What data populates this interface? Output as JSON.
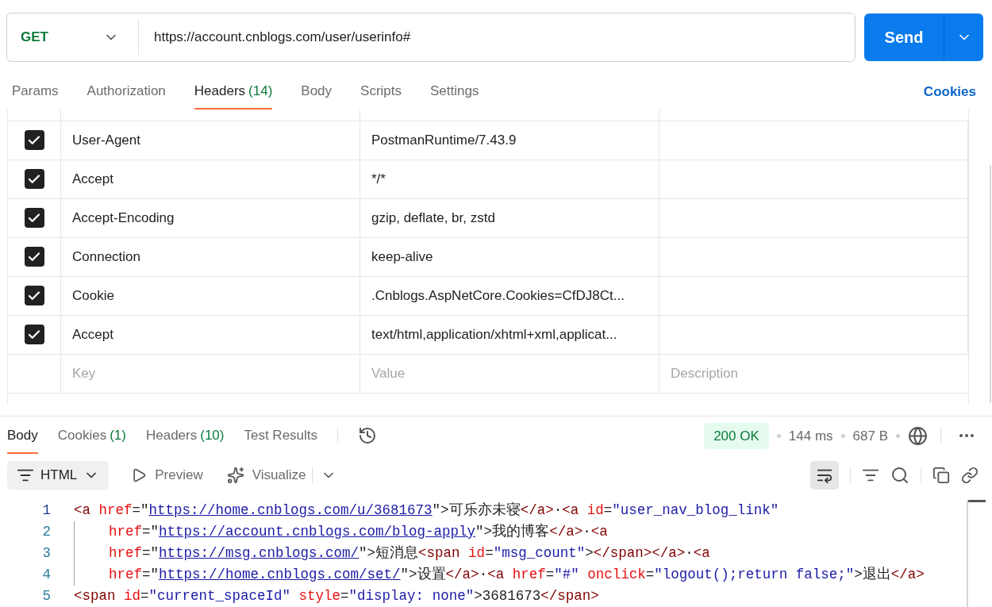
{
  "request": {
    "method": "GET",
    "url": "https://account.cnblogs.com/user/userinfo#",
    "send": "Send"
  },
  "request_tabs": [
    {
      "label": "Params",
      "selected": false
    },
    {
      "label": "Authorization",
      "selected": false
    },
    {
      "label": "Headers",
      "count": "(14)",
      "selected": true
    },
    {
      "label": "Body",
      "selected": false
    },
    {
      "label": "Scripts",
      "selected": false
    },
    {
      "label": "Settings",
      "selected": false
    }
  ],
  "cookies_link": "Cookies",
  "headers": {
    "rows": [
      {
        "checked": true,
        "key": "User-Agent",
        "value": "PostmanRuntime/7.43.9"
      },
      {
        "checked": true,
        "key": "Accept",
        "value": "*/*"
      },
      {
        "checked": true,
        "key": "Accept-Encoding",
        "value": "gzip, deflate, br, zstd"
      },
      {
        "checked": true,
        "key": "Connection",
        "value": "keep-alive"
      },
      {
        "checked": true,
        "key": "Cookie",
        "value": ".Cnblogs.AspNetCore.Cookies=CfDJ8Ct..."
      },
      {
        "checked": true,
        "key": "Accept",
        "value": "text/html,application/xhtml+xml,applicat..."
      }
    ],
    "new_row": [
      {
        "placeholder": "Key"
      },
      {
        "placeholder": "Value"
      },
      {
        "placeholder": "Description"
      }
    ]
  },
  "response": {
    "tabs": [
      {
        "label": "Body",
        "selected": true
      },
      {
        "label": "Cookies",
        "count": "(1)",
        "selected": false
      },
      {
        "label": "Headers",
        "count": "(10)",
        "selected": false
      },
      {
        "label": "Test Results",
        "selected": false
      }
    ],
    "status": "200 OK",
    "time": "144 ms",
    "size": "687 B",
    "format": "HTML",
    "preview": "Preview",
    "visualize": "Visualize",
    "wrap_on": true
  },
  "code": [
    {
      "number": "1",
      "continuation": false,
      "tokens": [
        {
          "kind": "tag",
          "text": "<a "
        },
        {
          "kind": "attr",
          "text": "href"
        },
        {
          "kind": "punct",
          "text": "=\""
        },
        {
          "kind": "link",
          "text": "https://home.cnblogs.com/u/3681673"
        },
        {
          "kind": "punct",
          "text": "\">可乐亦未寝"
        },
        {
          "kind": "tag",
          "text": "</a>"
        },
        {
          "kind": "punct",
          "text": "·"
        },
        {
          "kind": "tag",
          "text": "<a "
        },
        {
          "kind": "attr",
          "text": "id"
        },
        {
          "kind": "punct",
          "text": "="
        },
        {
          "kind": "string",
          "text": "\"user_nav_blog_link\""
        }
      ]
    },
    {
      "number": "2",
      "continuation": true,
      "tokens": [
        {
          "kind": "attr",
          "text": "href"
        },
        {
          "kind": "punct",
          "text": "=\""
        },
        {
          "kind": "link",
          "text": "https://account.cnblogs.com/blog-apply"
        },
        {
          "kind": "punct",
          "text": "\">我的博客"
        },
        {
          "kind": "tag",
          "text": "</a>"
        },
        {
          "kind": "punct",
          "text": "·"
        },
        {
          "kind": "tag",
          "text": "<a"
        }
      ]
    },
    {
      "number": "3",
      "continuation": true,
      "tokens": [
        {
          "kind": "attr",
          "text": "href"
        },
        {
          "kind": "punct",
          "text": "=\""
        },
        {
          "kind": "link",
          "text": "https://msg.cnblogs.com/"
        },
        {
          "kind": "punct",
          "text": "\">短消息"
        },
        {
          "kind": "tag",
          "text": "<span "
        },
        {
          "kind": "attr",
          "text": "id"
        },
        {
          "kind": "punct",
          "text": "="
        },
        {
          "kind": "string",
          "text": "\"msg_count\""
        },
        {
          "kind": "punct",
          "text": ">"
        },
        {
          "kind": "tag",
          "text": "</span></a>"
        },
        {
          "kind": "punct",
          "text": "·"
        },
        {
          "kind": "tag",
          "text": "<a"
        }
      ]
    },
    {
      "number": "4",
      "continuation": true,
      "tokens": [
        {
          "kind": "attr",
          "text": "href"
        },
        {
          "kind": "punct",
          "text": "=\""
        },
        {
          "kind": "link",
          "text": "https://home.cnblogs.com/set/"
        },
        {
          "kind": "punct",
          "text": "\">设置"
        },
        {
          "kind": "tag",
          "text": "</a>"
        },
        {
          "kind": "punct",
          "text": "·"
        },
        {
          "kind": "tag",
          "text": "<a "
        },
        {
          "kind": "attr",
          "text": "href"
        },
        {
          "kind": "punct",
          "text": "="
        },
        {
          "kind": "string",
          "text": "\"#\" "
        },
        {
          "kind": "attr",
          "text": "onclick"
        },
        {
          "kind": "punct",
          "text": "="
        },
        {
          "kind": "string",
          "text": "\"logout();return false;\""
        },
        {
          "kind": "punct",
          "text": ">退出"
        },
        {
          "kind": "tag",
          "text": "</a>"
        }
      ]
    },
    {
      "number": "5",
      "continuation": false,
      "tokens": [
        {
          "kind": "tag",
          "text": "<span "
        },
        {
          "kind": "attr",
          "text": "id"
        },
        {
          "kind": "punct",
          "text": "="
        },
        {
          "kind": "string",
          "text": "\"current_spaceId\" "
        },
        {
          "kind": "attr",
          "text": "style"
        },
        {
          "kind": "punct",
          "text": "="
        },
        {
          "kind": "string",
          "text": "\"display: none\""
        },
        {
          "kind": "punct",
          "text": ">3681673"
        },
        {
          "kind": "tag",
          "text": "</span>"
        }
      ]
    }
  ]
}
